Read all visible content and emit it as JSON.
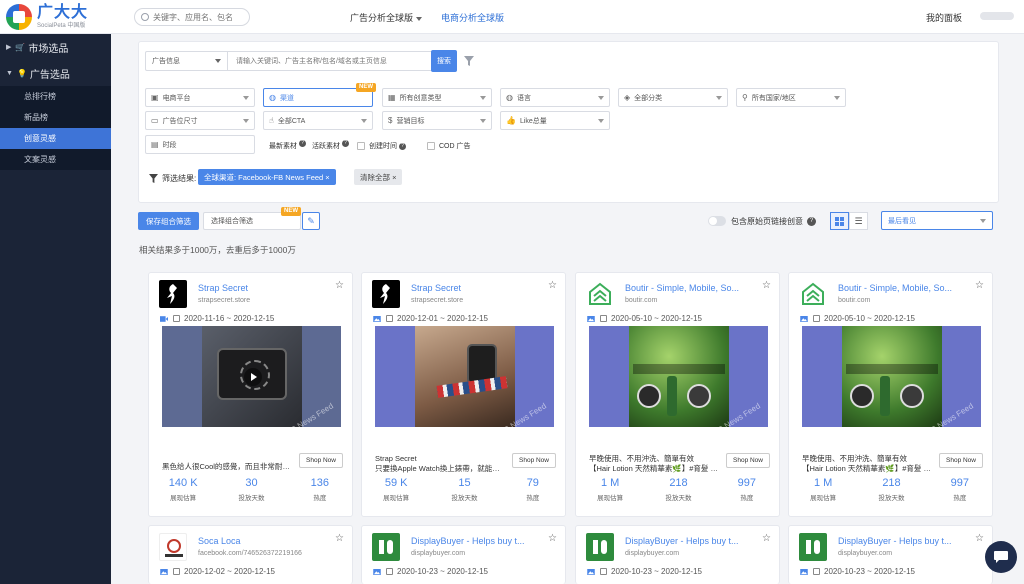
{
  "brand": {
    "name": "广大大",
    "subtitle": "SocialPeta 中国版"
  },
  "topbar": {
    "search_placeholder": "关键字、应用名、包名",
    "tabs": [
      {
        "label": "广告分析全球版",
        "has_dropdown": true
      },
      {
        "label": "电商分析全球版",
        "active": true
      }
    ],
    "dashboard": "我的面板"
  },
  "sidebar": {
    "groups": [
      {
        "label": "市场选品",
        "icon": "cart-icon"
      },
      {
        "label": "广告选品",
        "icon": "bulb-icon",
        "open": true
      }
    ],
    "items": [
      {
        "label": "总排行榜"
      },
      {
        "label": "新品榜"
      },
      {
        "label": "创意灵感",
        "active": true
      },
      {
        "label": "文案灵感"
      }
    ]
  },
  "filters": {
    "search_type": "广告信息",
    "search_placeholder": "请输入关键词、广告主名称/包名/域名或主页信息",
    "search_button": "搜索",
    "row1": [
      "电商平台",
      "渠道",
      "所有创意类型",
      "语言",
      "全部分类",
      "所有国家/地区"
    ],
    "row2": [
      "广告位尺寸",
      "全部CTA",
      "营销目标",
      "Like总量"
    ],
    "time": "时段",
    "latest": "最新素材",
    "active_material": "活跃素材",
    "created_time": "创建时间",
    "cod": "COD 广告",
    "new_badge": "NEW",
    "result_label": "筛选结果:",
    "result_tag": "全球渠道: Facebook-FB News Feed ×",
    "clear_tag": "清除全部 ×"
  },
  "toolbar": {
    "save_combo": "保存组合筛选",
    "combo_placeholder": "选择组合筛选",
    "new_badge": "NEW",
    "toggle_label": "包含原始页链接创意",
    "sort": "最后看见"
  },
  "summary": "相关结果多于1000万，去重后多于1000万",
  "stat_labels": [
    "展现估算",
    "投放天数",
    "热度"
  ],
  "cards": [
    {
      "title": "Strap Secret",
      "domain": "strapsecret.store",
      "date": "2020-11-16 ~ 2020-12-15",
      "media_type": "video",
      "text1": "黑色给人很Cool的感覺，而且非常耐看...",
      "text2": "",
      "cta": "Shop Now",
      "stats": [
        "140 K",
        "30",
        "136"
      ],
      "watermark": "FB News Feed"
    },
    {
      "title": "Strap Secret",
      "domain": "strapsecret.store",
      "date": "2020-12-01 ~ 2020-12-15",
      "media_type": "image",
      "text1": "Strap Secret",
      "text2": "只要換Apple Watch換上錶帶，就能散...",
      "cta": "Shop Now",
      "stats": [
        "59 K",
        "15",
        "79"
      ],
      "watermark": "FB News Feed"
    },
    {
      "title": "Boutir - Simple, Mobile, So...",
      "domain": "boutir.com",
      "date": "2020-05-10 ~ 2020-12-15",
      "media_type": "image",
      "text1": "早晚使用、不用沖洗、簡單有效",
      "text2": "【Hair Lotion 天然精華素🌿】#育髮 #...",
      "cta": "Shop Now",
      "stats": [
        "1 M",
        "218",
        "997"
      ],
      "watermark": "FB News Feed"
    },
    {
      "title": "Boutir - Simple, Mobile, So...",
      "domain": "boutir.com",
      "date": "2020-05-10 ~ 2020-12-15",
      "media_type": "image",
      "text1": "早晚使用、不用沖洗、簡單有效",
      "text2": "【Hair Lotion 天然精華素🌿】#育髮 #...",
      "cta": "Shop Now",
      "stats": [
        "1 M",
        "218",
        "997"
      ],
      "watermark": "FB News Feed"
    }
  ],
  "cards_row2": [
    {
      "title": "Soca Loca",
      "domain": "facebook.com/746526372219166",
      "date": "2020-12-02 ~ 2020-12-15"
    },
    {
      "title": "DisplayBuyer - Helps buy t...",
      "domain": "displaybuyer.com",
      "date": "2020-10-23 ~ 2020-12-15"
    },
    {
      "title": "DisplayBuyer - Helps buy t...",
      "domain": "displaybuyer.com",
      "date": "2020-10-23 ~ 2020-12-15"
    },
    {
      "title": "DisplayBuyer - Helps buy t...",
      "domain": "displaybuyer.com",
      "date": "2020-10-23 ~ 2020-12-15"
    }
  ],
  "colors": {
    "accent": "#4a86e8",
    "sidebar": "#1b2437",
    "sidebar_active": "#3e74d7",
    "new_badge": "#f5a623"
  }
}
